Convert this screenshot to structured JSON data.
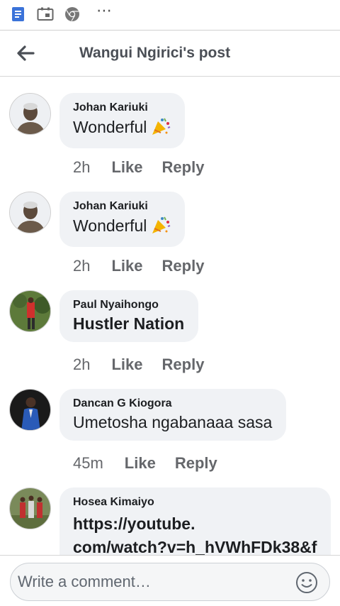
{
  "status_bar": {
    "overflow_label": "⋯"
  },
  "header": {
    "title": "Wangui Ngirici's post"
  },
  "comments": [
    {
      "author": "Johan Kariuki",
      "text": "Wonderful",
      "emoji": "party-popper-emoji",
      "time": "2h",
      "like": "Like",
      "reply": "Reply"
    },
    {
      "author": "Johan Kariuki",
      "text": "Wonderful",
      "emoji": "party-popper-emoji",
      "time": "2h",
      "like": "Like",
      "reply": "Reply"
    },
    {
      "author": "Paul Nyaihongo",
      "text": "Hustler Nation",
      "time": "2h",
      "like": "Like",
      "reply": "Reply"
    },
    {
      "author": "Dancan G Kiogora",
      "text": "Umetosha ngabanaaa sasa",
      "time": "45m",
      "like": "Like",
      "reply": "Reply"
    },
    {
      "author": "Hosea Kimaiyo",
      "text_line1": "https://youtube.",
      "text_line2": "com/watch?v=h_hVWhFDk38&f"
    }
  ],
  "composer": {
    "placeholder": "Write a comment…"
  },
  "colors": {
    "bubble": "#f0f2f5",
    "meta_text": "#65676b",
    "header_text": "#4b4f56"
  }
}
